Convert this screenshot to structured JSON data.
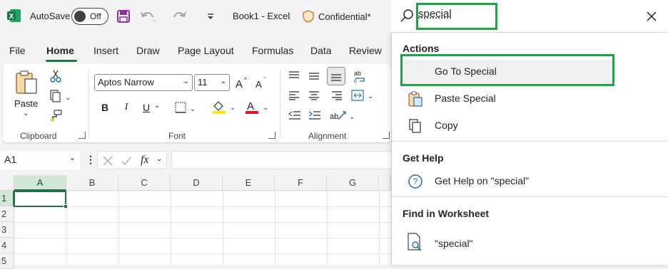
{
  "titlebar": {
    "autosave_label": "AutoSave",
    "autosave_state": "Off",
    "book_title": "Book1  -  Excel",
    "confidential_label": "Confidential*"
  },
  "tabs": [
    "File",
    "Home",
    "Insert",
    "Draw",
    "Page Layout",
    "Formulas",
    "Data",
    "Review"
  ],
  "active_tab": "Home",
  "ribbon": {
    "paste_label": "Paste",
    "clipboard_label": "Clipboard",
    "font_label": "Font",
    "alignment_label": "Alignment",
    "font_name": "Aptos Narrow",
    "font_size": "11",
    "bold": "B",
    "italic": "I",
    "underline": "U",
    "grow_font": "A^",
    "shrink_font": "A˅",
    "wrap_glyph": "ab↵c"
  },
  "formula_bar": {
    "name_box": "A1",
    "fx": "fx"
  },
  "grid": {
    "columns": [
      "A",
      "B",
      "C",
      "D",
      "E",
      "F",
      "G"
    ],
    "rows": [
      "1",
      "2",
      "3",
      "4",
      "5"
    ],
    "active_cell": "A1"
  },
  "search": {
    "query": "special"
  },
  "dropdown": {
    "actions_title": "Actions",
    "actions": [
      {
        "label": "Go To Special",
        "icon": "none"
      },
      {
        "label": "Paste Special",
        "icon": "paste-special-icon"
      },
      {
        "label": "Copy",
        "icon": "copy-icon"
      }
    ],
    "help_title": "Get Help",
    "help_item": "Get Help on \"special\"",
    "find_title": "Find in Worksheet",
    "find_item": "\"special\""
  },
  "colors": {
    "excel_green": "#217346",
    "highlight_green": "#1ea34a",
    "save_purple": "#8b2fa3",
    "font_color_red": "#e81123",
    "highlight_yellow": "#ffe600"
  }
}
